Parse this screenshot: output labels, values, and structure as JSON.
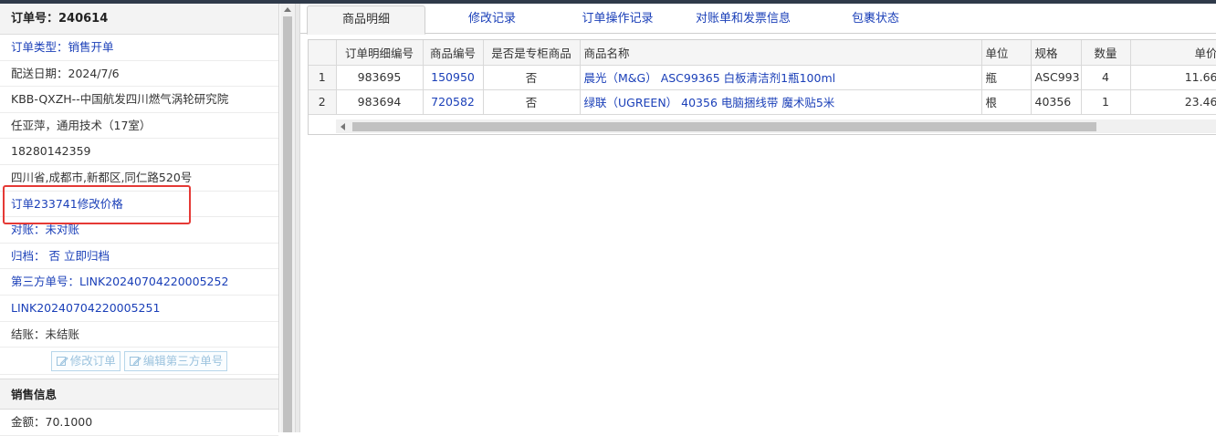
{
  "left_panel": {
    "title": "订单号：240614",
    "rows": [
      {
        "text": "订单类型：销售开单",
        "link": true
      },
      {
        "text": "配送日期：2024/7/6",
        "link": false
      },
      {
        "text": "KBB-QXZH--中国航发四川燃气涡轮研究院",
        "link": false
      },
      {
        "text": "任亚萍，通用技术（17室）",
        "link": false
      },
      {
        "text": "18280142359",
        "link": false
      },
      {
        "text": "四川省,成都市,新都区,同仁路520号",
        "link": false
      },
      {
        "text": "订单233741修改价格",
        "link": true
      },
      {
        "text": "对账：未对账",
        "link": true
      },
      {
        "text": "归档： 否 立即归档",
        "link": true
      },
      {
        "text": "第三方单号：LINK20240704220005252",
        "link": true
      },
      {
        "text": "LINK20240704220005251",
        "link": true
      },
      {
        "text": "结账：未结账",
        "link": false
      }
    ],
    "buttons": {
      "edit_order": "修改订单",
      "edit_third_party": "编辑第三方单号"
    },
    "sales_section": {
      "title": "销售信息",
      "amount": "金额：70.1000"
    }
  },
  "tabs": [
    {
      "label": "商品明细",
      "active": true
    },
    {
      "label": "修改记录",
      "active": false
    },
    {
      "label": "订单操作记录",
      "active": false
    },
    {
      "label": "对账单和发票信息",
      "active": false
    },
    {
      "label": "包裹状态",
      "active": false
    }
  ],
  "table": {
    "columns": [
      "",
      "订单明细编号",
      "商品编号",
      "是否是专柜商品",
      "商品名称",
      "单位",
      "规格",
      "数量",
      "单价"
    ],
    "rows": [
      {
        "no": "1",
        "detail_id": "983695",
        "product_id": "150950",
        "is_counter": "否",
        "name": "晨光（M&G） ASC99365 白板清洁剂1瓶100ml",
        "unit": "瓶",
        "spec": "ASC993",
        "qty": "4",
        "price": "11.66"
      },
      {
        "no": "2",
        "detail_id": "983694",
        "product_id": "720582",
        "is_counter": "否",
        "name": "绿联（UGREEN） 40356 电脑捆线带 魔术贴5米",
        "unit": "根",
        "spec": "40356",
        "qty": "1",
        "price": "23.46"
      }
    ]
  },
  "colors": {
    "link": "#1a3fb8",
    "highlight": "#e53935"
  }
}
